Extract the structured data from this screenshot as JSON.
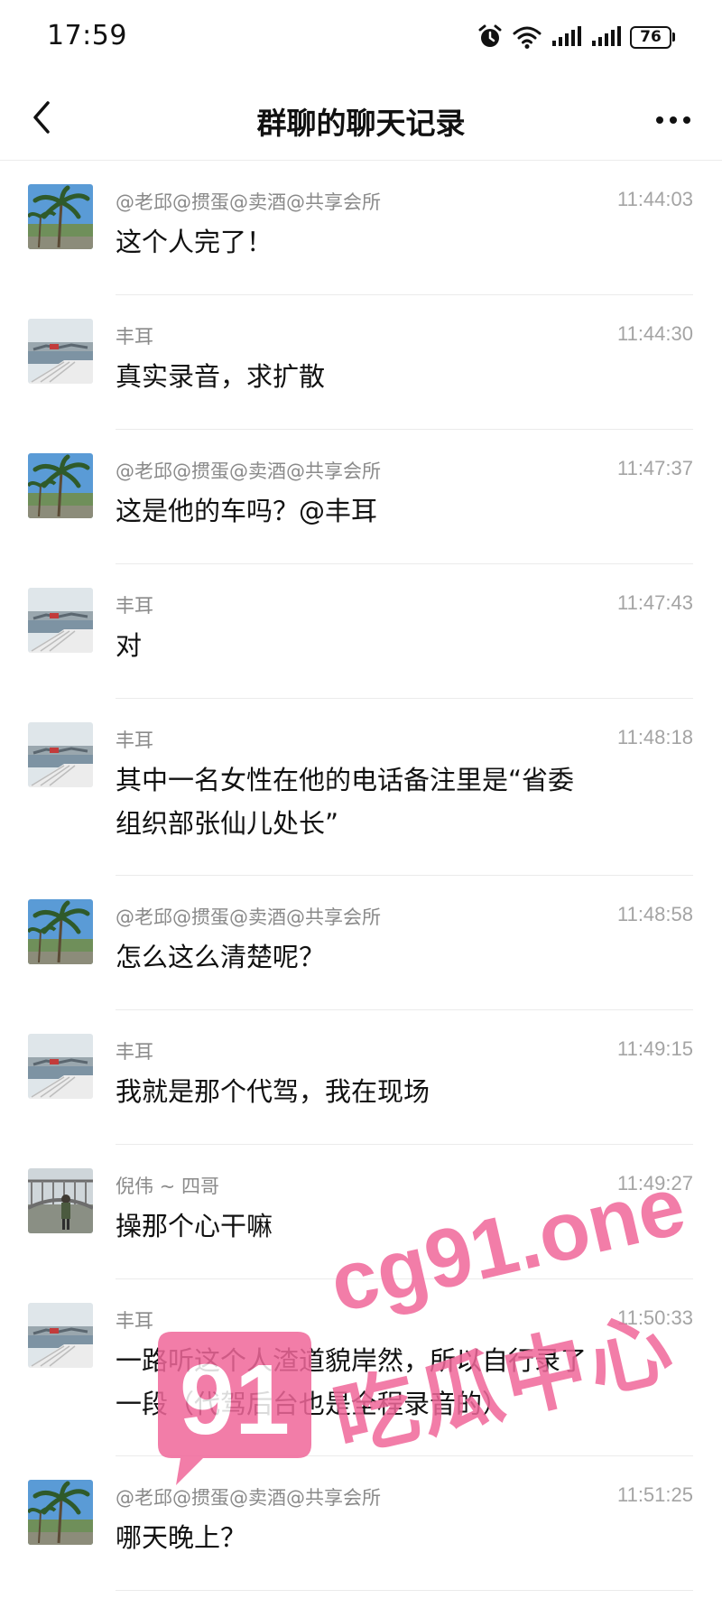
{
  "status_bar": {
    "time": "17:59",
    "icons": [
      "alarm-icon",
      "wifi-icon",
      "signal-icon",
      "signal-icon"
    ],
    "battery": "76"
  },
  "nav": {
    "back_icon": "chevron-left-icon",
    "title": "群聊的聊天记录",
    "more_icon": "more-dots-icon"
  },
  "messages": [
    {
      "sender": "@老邱@掼蛋@卖酒@共享会所",
      "time": "11:44:03",
      "text": "这个人完了！",
      "avatar": "palm-tree"
    },
    {
      "sender": "丰耳",
      "time": "11:44:30",
      "text": "真实录音，求扩散",
      "avatar": "harbor"
    },
    {
      "sender": "@老邱@掼蛋@卖酒@共享会所",
      "time": "11:47:37",
      "text": "这是他的车吗？@丰耳",
      "avatar": "palm-tree"
    },
    {
      "sender": "丰耳",
      "time": "11:47:43",
      "text": "对",
      "avatar": "harbor"
    },
    {
      "sender": "丰耳",
      "time": "11:48:18",
      "text": "其中一名女性在他的电话备注里是“省委\n组织部张仙儿处长”",
      "avatar": "harbor"
    },
    {
      "sender": "@老邱@掼蛋@卖酒@共享会所",
      "time": "11:48:58",
      "text": "怎么这么清楚呢？",
      "avatar": "palm-tree"
    },
    {
      "sender": "丰耳",
      "time": "11:49:15",
      "text": "我就是那个代驾，我在现场",
      "avatar": "harbor"
    },
    {
      "sender": "倪伟 ~ 四哥",
      "time": "11:49:27",
      "text": "操那个心干嘛",
      "avatar": "bridge"
    },
    {
      "sender": "丰耳",
      "time": "11:50:33",
      "text": "一路听这个人渣道貌岸然，所以自行录了\n一段（代驾后台也是全程录音的）",
      "avatar": "harbor"
    },
    {
      "sender": "@老邱@掼蛋@卖酒@共享会所",
      "time": "11:51:25",
      "text": "哪天晚上？",
      "avatar": "palm-tree"
    }
  ],
  "watermark": {
    "logo": "91",
    "site": "cg91.one",
    "name": "吃瓜中心",
    "color": "#f0679a"
  }
}
